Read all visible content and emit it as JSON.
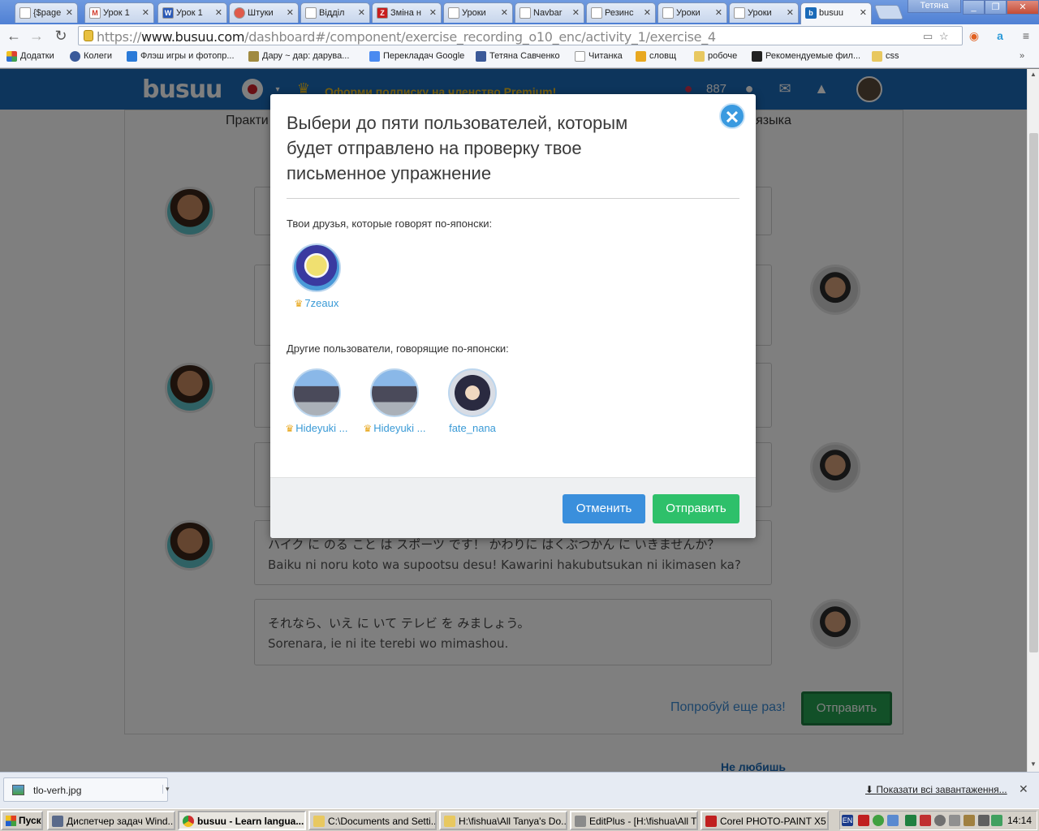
{
  "browser": {
    "tabs": [
      {
        "label": "{$page",
        "active": false
      },
      {
        "label": "Урок 1",
        "active": false
      },
      {
        "label": "Урок 1",
        "active": false
      },
      {
        "label": "Штуки",
        "active": false
      },
      {
        "label": "Відділ",
        "active": false
      },
      {
        "label": "Зміна н",
        "active": false
      },
      {
        "label": "Уроки",
        "active": false
      },
      {
        "label": "Navbar",
        "active": false
      },
      {
        "label": "Резинс",
        "active": false
      },
      {
        "label": "Уроки",
        "active": false
      },
      {
        "label": "Уроки",
        "active": false
      },
      {
        "label": "busuu",
        "active": true
      }
    ],
    "user_label": "Тетяна",
    "url_scheme": "https://",
    "url_host": "www.busuu.com",
    "url_path": "/dashboard#/component/exercise_recording_o10_enc/activity_1/exercise_4",
    "bookmarks": [
      "Додатки",
      "Колеги",
      "Флэш игры и фотопр...",
      "Дару ~ дар: дарува...",
      "Перекладач Google",
      "Тетяна Савченко",
      "Читанка",
      "словщ",
      "робоче",
      "Рекомендуемые фил...",
      "css"
    ]
  },
  "site": {
    "logo": "busuu",
    "premium_banner": "Оформи подписку на членство Premium!",
    "points": "887",
    "practice_label": "Практи",
    "language_label": "я языка",
    "dialogue": [
      {
        "speaker": "female",
        "jp": "ハイク に のる こと は スポーツ です！ かわりに はくぶつかん に いきませんか？",
        "romaji": "Baiku ni noru koto wa supootsu desu! Kawarini hakubutsukan ni ikimasen ka?"
      },
      {
        "speaker": "male",
        "jp": "それなら、いえ に いて テレビ を みましょう。",
        "romaji": "Sorenara, ie ni ite terebi wo mimashou."
      }
    ],
    "retry_label": "Попробуй еще раз!",
    "send_label": "Отправить",
    "dislike_label": "Не любишь"
  },
  "modal": {
    "title": "Выбери до пяти пользователей, которым будет отправлено на проверку твое письменное упражнение",
    "friends_heading": "Твои друзья, которые говорят по-японски:",
    "friends": [
      {
        "name": "7zeaux",
        "premium": true
      }
    ],
    "others_heading": "Другие пользователи, говорящие по-японски:",
    "others": [
      {
        "name": "Hideyuki ...",
        "premium": true
      },
      {
        "name": "Hideyuki ...",
        "premium": true
      },
      {
        "name": "fate_nana",
        "premium": false
      }
    ],
    "cancel_label": "Отменить",
    "send_label": "Отправить"
  },
  "downloads": {
    "file": "tlo-verh.jpg",
    "show_all": "Показати всі завантаження..."
  },
  "taskbar": {
    "start_label": "Пуск",
    "tasks": [
      {
        "label": "Диспетчер задач Wind...",
        "active": false
      },
      {
        "label": "busuu - Learn langua...",
        "active": true
      },
      {
        "label": "C:\\Documents and Setti...",
        "active": false
      },
      {
        "label": "H:\\fishua\\All Tanya's Do...",
        "active": false
      },
      {
        "label": "EditPlus - [H:\\fishua\\All T...",
        "active": false
      },
      {
        "label": "Corel PHOTO-PAINT X5",
        "active": false
      }
    ],
    "lang": "EN",
    "clock": "14:14"
  },
  "colors": {
    "brand_blue": "#1a6ab8",
    "link_blue": "#3a9ad6",
    "cancel_blue": "#3a8fdc",
    "send_green": "#2ec06a",
    "premium_gold": "#e8a820"
  }
}
